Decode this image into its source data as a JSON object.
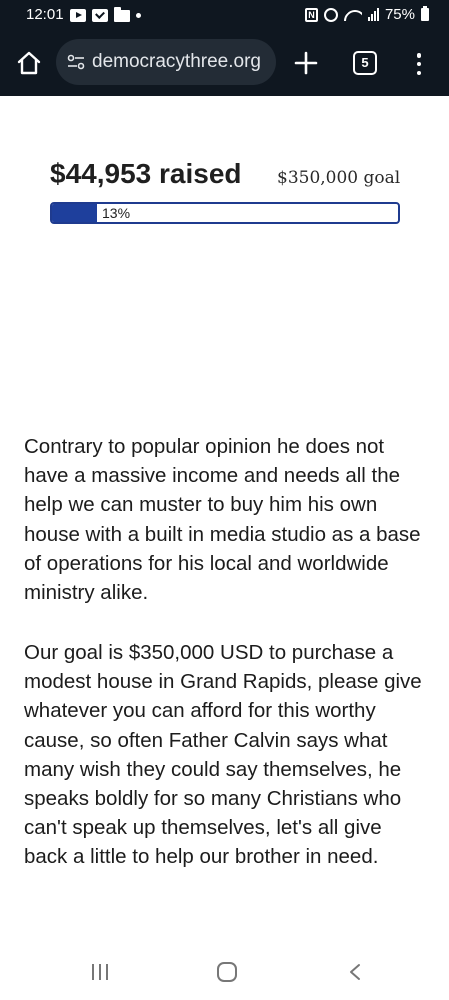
{
  "status_bar": {
    "time": "12:01",
    "battery": "75%"
  },
  "browser": {
    "url": "democracythree.org",
    "tab_count": "5",
    "icons": [
      "home-icon",
      "site-settings-icon",
      "new-tab-plus-icon",
      "tab-switcher-icon",
      "overflow-menu-icon"
    ]
  },
  "fundraiser": {
    "raised": "$44,953 raised",
    "goal": "$350,000 goal",
    "progress_label": "13%",
    "progress_fraction": 0.13,
    "accent_color": "#1e3f9c"
  },
  "content": {
    "paragraph1": "Contrary to popular opinion he does not have a massive income and needs all the help we can muster to buy him his own house with a built in media studio as a base of operations for his local and worldwide ministry alike.",
    "paragraph2": "Our goal is $350,000 USD to purchase a modest house in Grand Rapids, please give whatever you can afford for this worthy cause, so often Father Calvin says what many wish they could say themselves, he speaks boldly for so many Christians who can't speak up themselves, let's all give back a little to help our brother in need."
  },
  "nav_bar": {
    "icons": [
      "recents-icon",
      "home-icon",
      "back-icon"
    ]
  }
}
